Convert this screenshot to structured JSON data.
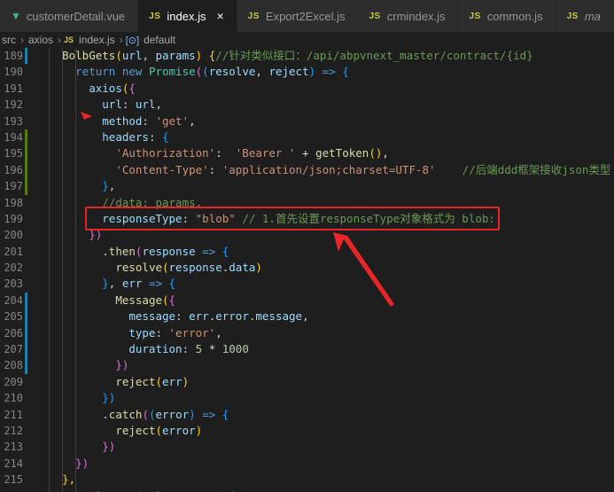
{
  "tabs": [
    {
      "label": "customerDetail.vue",
      "icon": "vue-icon",
      "active": false
    },
    {
      "label": "index.js",
      "icon": "js-icon",
      "active": true
    },
    {
      "label": "Export2Excel.js",
      "icon": "js-icon",
      "active": false
    },
    {
      "label": "crmindex.js",
      "icon": "js-icon",
      "active": false
    },
    {
      "label": "common.js",
      "icon": "js-icon",
      "active": false
    },
    {
      "label": "ma",
      "icon": "js-icon",
      "active": false
    }
  ],
  "js_icon_text": "JS",
  "breadcrumb": {
    "items": [
      "src",
      "axios",
      "index.js",
      "default"
    ]
  },
  "lines": [
    {
      "n": "189",
      "tokens": [
        {
          "t": "    "
        },
        {
          "t": "BolbGets",
          "c": "fn"
        },
        {
          "t": "(",
          "c": "br1"
        },
        {
          "t": "url",
          "c": "prop"
        },
        {
          "t": ", "
        },
        {
          "t": "params",
          "c": "prop"
        },
        {
          "t": ")",
          "c": "br1"
        },
        {
          "t": " {",
          "c": "br1"
        },
        {
          "t": "//针对类似接口：/api/abpvnext_master/contract/{id}",
          "c": "cmt"
        }
      ]
    },
    {
      "n": "190",
      "tokens": [
        {
          "t": "      "
        },
        {
          "t": "return",
          "c": "kw"
        },
        {
          "t": " "
        },
        {
          "t": "new",
          "c": "kw"
        },
        {
          "t": " "
        },
        {
          "t": "Promise",
          "c": "cls"
        },
        {
          "t": "(",
          "c": "br2"
        },
        {
          "t": "(",
          "c": "br3"
        },
        {
          "t": "resolve",
          "c": "prop"
        },
        {
          "t": ", "
        },
        {
          "t": "reject",
          "c": "prop"
        },
        {
          "t": ")",
          "c": "br3"
        },
        {
          "t": " => ",
          "c": "kw"
        },
        {
          "t": "{",
          "c": "br3"
        }
      ]
    },
    {
      "n": "191",
      "tokens": [
        {
          "t": "        "
        },
        {
          "t": "axios",
          "c": "prop"
        },
        {
          "t": "(",
          "c": "br1"
        },
        {
          "t": "{",
          "c": "br2"
        }
      ]
    },
    {
      "n": "192",
      "tokens": [
        {
          "t": "          "
        },
        {
          "t": "url",
          "c": "prop"
        },
        {
          "t": ": "
        },
        {
          "t": "url",
          "c": "prop"
        },
        {
          "t": ","
        }
      ]
    },
    {
      "n": "193",
      "tokens": [
        {
          "t": "          "
        },
        {
          "t": "method",
          "c": "prop"
        },
        {
          "t": ": "
        },
        {
          "t": "'get'",
          "c": "str"
        },
        {
          "t": ","
        }
      ]
    },
    {
      "n": "194",
      "tokens": [
        {
          "t": "          "
        },
        {
          "t": "headers",
          "c": "prop"
        },
        {
          "t": ": "
        },
        {
          "t": "{",
          "c": "br3"
        }
      ]
    },
    {
      "n": "195",
      "tokens": [
        {
          "t": "            "
        },
        {
          "t": "'Authorization'",
          "c": "str"
        },
        {
          "t": ":  "
        },
        {
          "t": "'Bearer '",
          "c": "str"
        },
        {
          "t": " + "
        },
        {
          "t": "getToken",
          "c": "fn"
        },
        {
          "t": "(",
          "c": "br1"
        },
        {
          "t": ")",
          "c": "br1"
        },
        {
          "t": ","
        }
      ]
    },
    {
      "n": "196",
      "tokens": [
        {
          "t": "            "
        },
        {
          "t": "'Content-Type'",
          "c": "str"
        },
        {
          "t": ": "
        },
        {
          "t": "'application/json;charset=UTF-8'",
          "c": "str"
        },
        {
          "t": "    "
        },
        {
          "t": "//后端ddd框架接收json类型",
          "c": "cmt"
        }
      ]
    },
    {
      "n": "197",
      "tokens": [
        {
          "t": "          "
        },
        {
          "t": "}",
          "c": "br3"
        },
        {
          "t": ","
        }
      ]
    },
    {
      "n": "198",
      "tokens": [
        {
          "t": "          "
        },
        {
          "t": "//data: params,",
          "c": "cmt"
        }
      ]
    },
    {
      "n": "199",
      "tokens": [
        {
          "t": "          "
        },
        {
          "t": "responseType",
          "c": "prop"
        },
        {
          "t": ": "
        },
        {
          "t": "\"blob\"",
          "c": "str"
        },
        {
          "t": " "
        },
        {
          "t": "// 1.首先设置responseType对象格式为 blob:",
          "c": "cmt"
        }
      ]
    },
    {
      "n": "200",
      "tokens": [
        {
          "t": "        "
        },
        {
          "t": "})",
          "c": "br2"
        }
      ]
    },
    {
      "n": "201",
      "tokens": [
        {
          "t": "          ."
        },
        {
          "t": "then",
          "c": "fn"
        },
        {
          "t": "(",
          "c": "br2"
        },
        {
          "t": "response",
          "c": "prop"
        },
        {
          "t": " => ",
          "c": "kw"
        },
        {
          "t": "{",
          "c": "br3"
        }
      ]
    },
    {
      "n": "202",
      "tokens": [
        {
          "t": "            "
        },
        {
          "t": "resolve",
          "c": "fn"
        },
        {
          "t": "(",
          "c": "br1"
        },
        {
          "t": "response",
          "c": "prop"
        },
        {
          "t": "."
        },
        {
          "t": "data",
          "c": "prop"
        },
        {
          "t": ")",
          "c": "br1"
        }
      ]
    },
    {
      "n": "203",
      "tokens": [
        {
          "t": "          "
        },
        {
          "t": "}",
          "c": "br3"
        },
        {
          "t": ", "
        },
        {
          "t": "err",
          "c": "prop"
        },
        {
          "t": " => ",
          "c": "kw"
        },
        {
          "t": "{",
          "c": "br3"
        }
      ]
    },
    {
      "n": "204",
      "tokens": [
        {
          "t": "            "
        },
        {
          "t": "Message",
          "c": "fn"
        },
        {
          "t": "(",
          "c": "br1"
        },
        {
          "t": "{",
          "c": "br2"
        }
      ]
    },
    {
      "n": "205",
      "tokens": [
        {
          "t": "              "
        },
        {
          "t": "message",
          "c": "prop"
        },
        {
          "t": ": "
        },
        {
          "t": "err",
          "c": "prop"
        },
        {
          "t": "."
        },
        {
          "t": "error",
          "c": "prop"
        },
        {
          "t": "."
        },
        {
          "t": "message",
          "c": "prop"
        },
        {
          "t": ","
        }
      ]
    },
    {
      "n": "206",
      "tokens": [
        {
          "t": "              "
        },
        {
          "t": "type",
          "c": "prop"
        },
        {
          "t": ": "
        },
        {
          "t": "'error'",
          "c": "str"
        },
        {
          "t": ","
        }
      ]
    },
    {
      "n": "207",
      "tokens": [
        {
          "t": "              "
        },
        {
          "t": "duration",
          "c": "prop"
        },
        {
          "t": ": "
        },
        {
          "t": "5",
          "c": "num"
        },
        {
          "t": " * "
        },
        {
          "t": "1000",
          "c": "num"
        }
      ]
    },
    {
      "n": "208",
      "tokens": [
        {
          "t": "            "
        },
        {
          "t": "})",
          "c": "br2"
        }
      ]
    },
    {
      "n": "209",
      "tokens": [
        {
          "t": "            "
        },
        {
          "t": "reject",
          "c": "fn"
        },
        {
          "t": "(",
          "c": "br1"
        },
        {
          "t": "err",
          "c": "prop"
        },
        {
          "t": ")",
          "c": "br1"
        }
      ]
    },
    {
      "n": "210",
      "tokens": [
        {
          "t": "          "
        },
        {
          "t": "})",
          "c": "br3"
        }
      ]
    },
    {
      "n": "211",
      "tokens": [
        {
          "t": "          ."
        },
        {
          "t": "catch",
          "c": "fn"
        },
        {
          "t": "(",
          "c": "br2"
        },
        {
          "t": "(",
          "c": "br3"
        },
        {
          "t": "error",
          "c": "prop"
        },
        {
          "t": ")",
          "c": "br3"
        },
        {
          "t": " => ",
          "c": "kw"
        },
        {
          "t": "{",
          "c": "br3"
        }
      ]
    },
    {
      "n": "212",
      "tokens": [
        {
          "t": "            "
        },
        {
          "t": "reject",
          "c": "fn"
        },
        {
          "t": "(",
          "c": "br1"
        },
        {
          "t": "error",
          "c": "prop"
        },
        {
          "t": ")",
          "c": "br1"
        }
      ]
    },
    {
      "n": "213",
      "tokens": [
        {
          "t": "          "
        },
        {
          "t": "})",
          "c": "br2"
        }
      ]
    },
    {
      "n": "214",
      "tokens": [
        {
          "t": "      "
        },
        {
          "t": "})",
          "c": "br2"
        }
      ]
    },
    {
      "n": "215",
      "tokens": [
        {
          "t": "    "
        },
        {
          "t": "},",
          "c": "br1"
        }
      ]
    },
    {
      "n": "216",
      "tokens": [
        {
          "t": "    "
        },
        {
          "t": "// BolbGets(url, params) {",
          "c": "cmt"
        }
      ]
    }
  ],
  "gutter_marks": [
    {
      "line": "189",
      "color": "#1b81a8"
    },
    {
      "line": "194",
      "color": "#587c0c"
    },
    {
      "line": "195",
      "color": "#587c0c"
    },
    {
      "line": "196",
      "color": "#587c0c"
    },
    {
      "line": "197",
      "color": "#587c0c"
    },
    {
      "line": "204",
      "color": "#1b81a8"
    },
    {
      "line": "205",
      "color": "#1b81a8"
    },
    {
      "line": "206",
      "color": "#1b81a8"
    },
    {
      "line": "207",
      "color": "#1b81a8"
    },
    {
      "line": "208",
      "color": "#1b81a8"
    }
  ],
  "annotation_color": "#e8262a"
}
